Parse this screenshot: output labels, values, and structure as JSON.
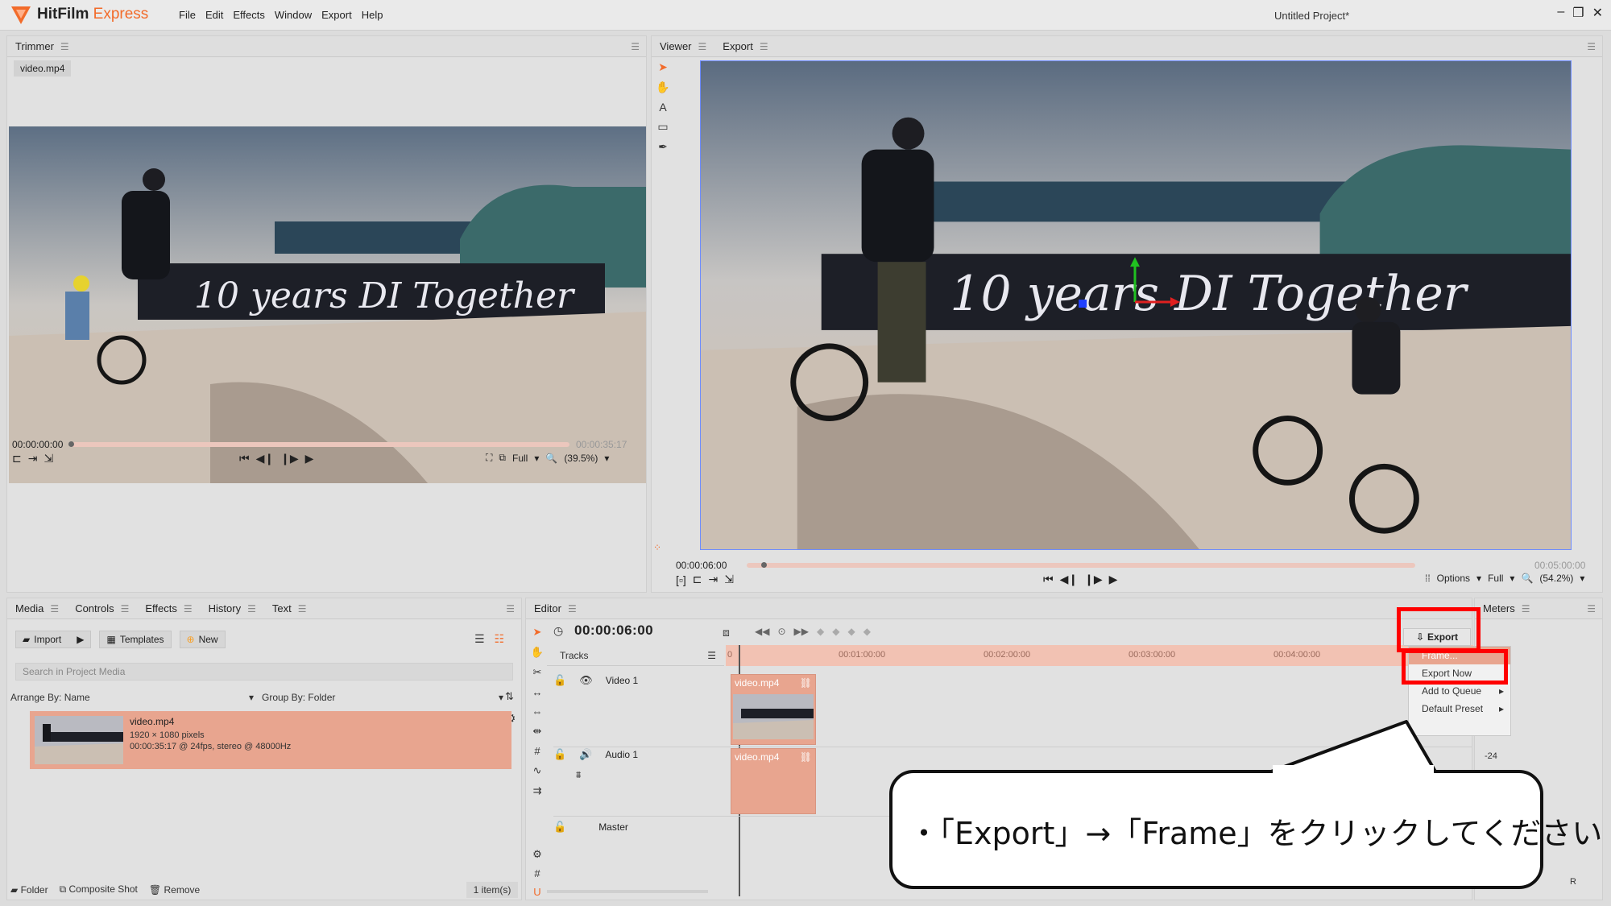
{
  "app": {
    "name": "HitFilm",
    "name_accent": "Express",
    "project_title": "Untitled Project*",
    "menu": [
      "File",
      "Edit",
      "Effects",
      "Window",
      "Export",
      "Help"
    ]
  },
  "trimmer": {
    "tab": "Trimmer",
    "file": "video.mp4",
    "timecode_start": "00:00:00:00",
    "timecode_end": "00:00:35:17",
    "quality": "Full",
    "zoom": "(39.5%)"
  },
  "viewer": {
    "tabs": [
      "Viewer",
      "Export"
    ],
    "timecode_start": "00:00:06:00",
    "timecode_end": "00:05:00:00",
    "options_label": "Options",
    "quality": "Full",
    "zoom": "(54.2%)"
  },
  "media": {
    "tabs": [
      "Media",
      "Controls",
      "Effects",
      "History",
      "Text"
    ],
    "buttons": {
      "import": "Import",
      "templates": "Templates",
      "new": "New"
    },
    "search_placeholder": "Search in Project Media",
    "arrange_by": "Arrange By: Name",
    "group_by": "Group By: Folder",
    "item": {
      "name": "video.mp4",
      "dimensions": "1920 × 1080 pixels",
      "info": "00:00:35:17 @ 24fps, stereo @ 48000Hz"
    },
    "footer": {
      "folder": "Folder",
      "composite": "Composite Shot",
      "remove": "Remove",
      "count": "1 item(s)"
    }
  },
  "editor": {
    "tab": "Editor",
    "timecode": "00:00:06:00",
    "tracks_label": "Tracks",
    "tracks": [
      {
        "name": "Video 1",
        "clip": "video.mp4"
      },
      {
        "name": "Audio 1",
        "clip": "video.mp4"
      },
      {
        "name": "Master"
      }
    ],
    "ruler": [
      "0",
      "00:01:00:00",
      "00:02:00:00",
      "00:03:00:00",
      "00:04:00:00"
    ],
    "export_button": "Export",
    "export_menu": [
      {
        "label": "Frame...",
        "highlighted": true,
        "submenu": false
      },
      {
        "label": "Export Now",
        "highlighted": false,
        "submenu": false
      },
      {
        "label": "Add to Queue",
        "highlighted": false,
        "submenu": true
      },
      {
        "label": "Default Preset",
        "highlighted": false,
        "submenu": true
      }
    ]
  },
  "meters": {
    "tab": "Meters",
    "level_label": "-24",
    "channel": "R"
  },
  "callout": {
    "text": "・「Export」→「Frame」をクリックしてください"
  },
  "colors": {
    "accent": "#f26b2a",
    "clip": "#e8a58f",
    "highlight_box": "#ff0000"
  }
}
